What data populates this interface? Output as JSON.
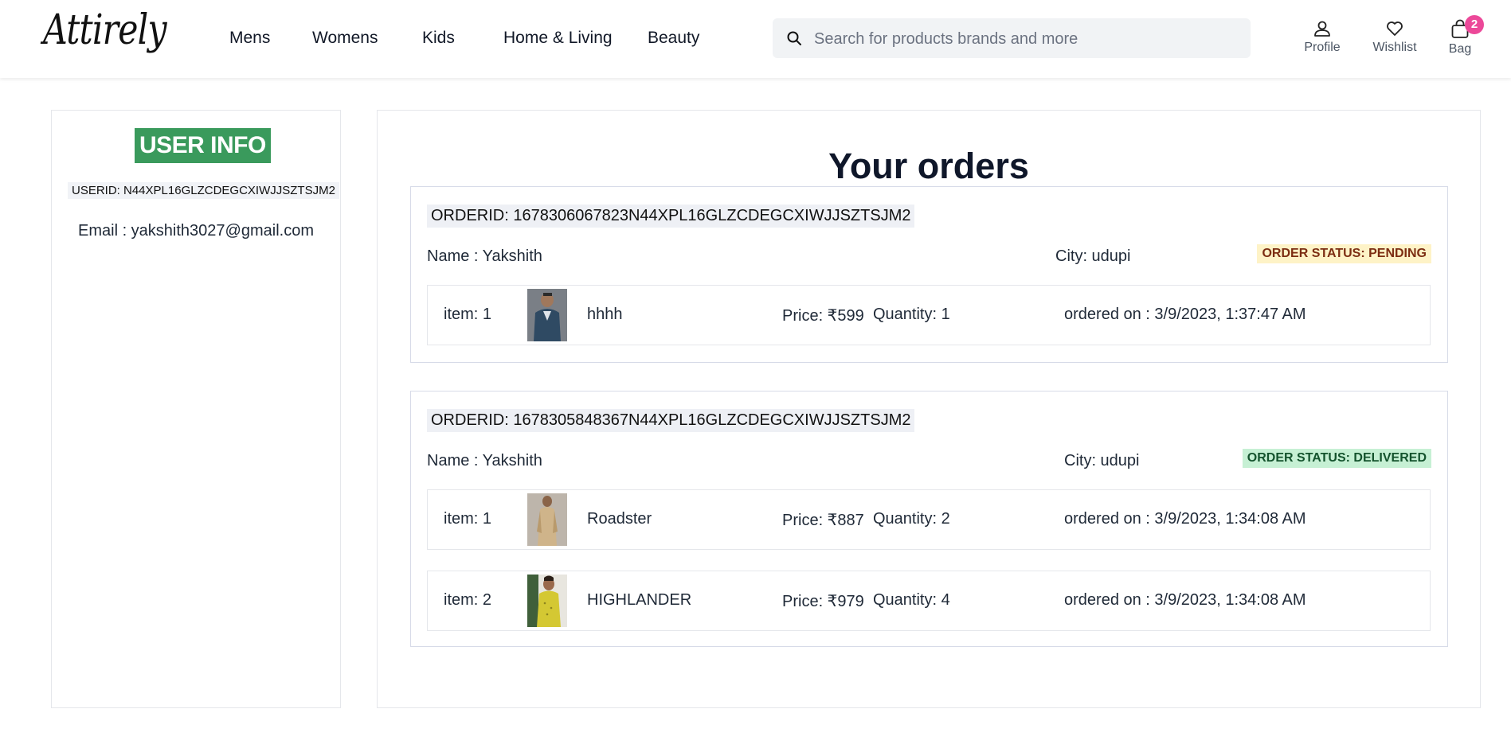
{
  "header": {
    "logo": "Attirely",
    "nav": [
      "Mens",
      "Womens",
      "Kids",
      "Home & Living",
      "Beauty"
    ],
    "search_placeholder": "Search for products brands and more",
    "actions": {
      "profile": "Profile",
      "wishlist": "Wishlist",
      "bag": "Bag",
      "bag_count": "2"
    },
    "badge_color": "#ec4899"
  },
  "user_info": {
    "title": "USER INFO",
    "user_id": "USERID: N44XPL16GLZCDEGCXIWJJSZTSJM2",
    "email": "Email : yakshith3027@gmail.com",
    "title_color": "#3a9a5c"
  },
  "orders": {
    "title": "Your orders",
    "list": [
      {
        "order_id": "ORDERID: 1678306067823N44XPL16GLZCDEGCXIWJJSZTSJM2",
        "name": "Name : Yakshith",
        "city": "City: udupi",
        "status": "ORDER STATUS: PENDING",
        "items": [
          {
            "item": "item: 1",
            "title": "hhhh",
            "price": "Price: ₹599",
            "quantity": "Quantity: 1",
            "ordered_on": "ordered on : 3/9/2023, 1:37:47 AM"
          }
        ]
      },
      {
        "order_id": "ORDERID: 1678305848367N44XPL16GLZCDEGCXIWJJSZTSJM2",
        "name": "Name : Yakshith",
        "city": "City: udupi",
        "status": "ORDER STATUS: DELIVERED",
        "items": [
          {
            "item": "item: 1",
            "title": "Roadster",
            "price": "Price: ₹887",
            "quantity": "Quantity: 2",
            "ordered_on": "ordered on : 3/9/2023, 1:34:08 AM"
          },
          {
            "item": "item: 2",
            "title": "HIGHLANDER",
            "price": "Price: ₹979",
            "quantity": "Quantity: 4",
            "ordered_on": "ordered on : 3/9/2023, 1:34:08 AM"
          }
        ]
      }
    ]
  }
}
